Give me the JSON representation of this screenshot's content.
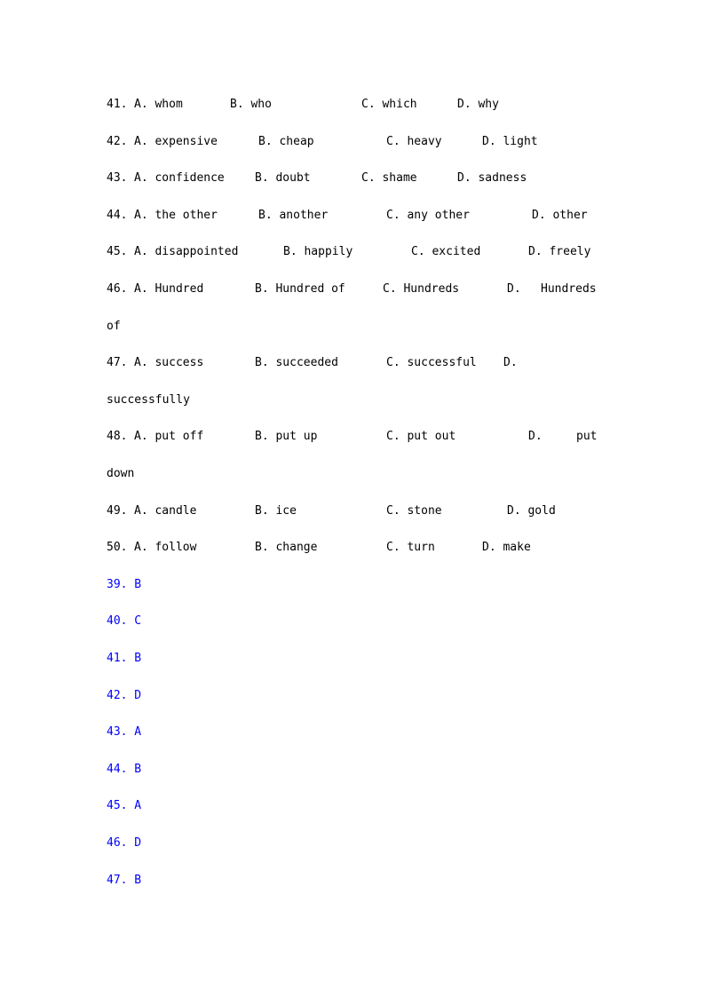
{
  "questions": [
    {
      "num": "41.",
      "a": "A. whom",
      "b": "B. who",
      "c": "C. which",
      "d": "D. why"
    },
    {
      "num": "42.",
      "a": "A. expensive",
      "b": "B. cheap",
      "c": "C. heavy",
      "d": "D. light"
    },
    {
      "num": "43.",
      "a": "A. confidence",
      "b": "B. doubt",
      "c": "C. shame",
      "d": "D. sadness"
    },
    {
      "num": "44.",
      "a": "A. the other",
      "b": "B. another",
      "c": "C. any other",
      "d": "D. other"
    },
    {
      "num": "45.",
      "a": "A. disappointed",
      "b": "B. happily",
      "c": "C. excited",
      "d": "D. freely"
    },
    {
      "num": "46.",
      "a": "A. Hundred",
      "b": "B. Hundred of",
      "c": "C. Hundreds",
      "d": "D.",
      "d_tail": "Hundreds",
      "wrap": "of"
    },
    {
      "num": "47.",
      "a": "A. success",
      "b": "B. succeeded",
      "c": "C. successful",
      "d": "D.",
      "wrap": "successfully"
    },
    {
      "num": "48.",
      "a": "A. put off",
      "b": "B. put up",
      "c": "C. put out",
      "d": "D.",
      "d_tail": "put",
      "wrap": "down"
    },
    {
      "num": "49.",
      "a": "A. candle",
      "b": "B. ice",
      "c": "C. stone",
      "d": "D. gold"
    },
    {
      "num": "50.",
      "a": "A. follow",
      "b": "B. change",
      "c": "C. turn",
      "d": "D. make"
    }
  ],
  "answers": [
    "39. B",
    "40. C",
    "41. B",
    "42. D",
    "43. A",
    "44. B",
    "45. A",
    "46. D",
    "47. B"
  ],
  "colors": {
    "text": "#000000",
    "answer": "#0000ff"
  }
}
